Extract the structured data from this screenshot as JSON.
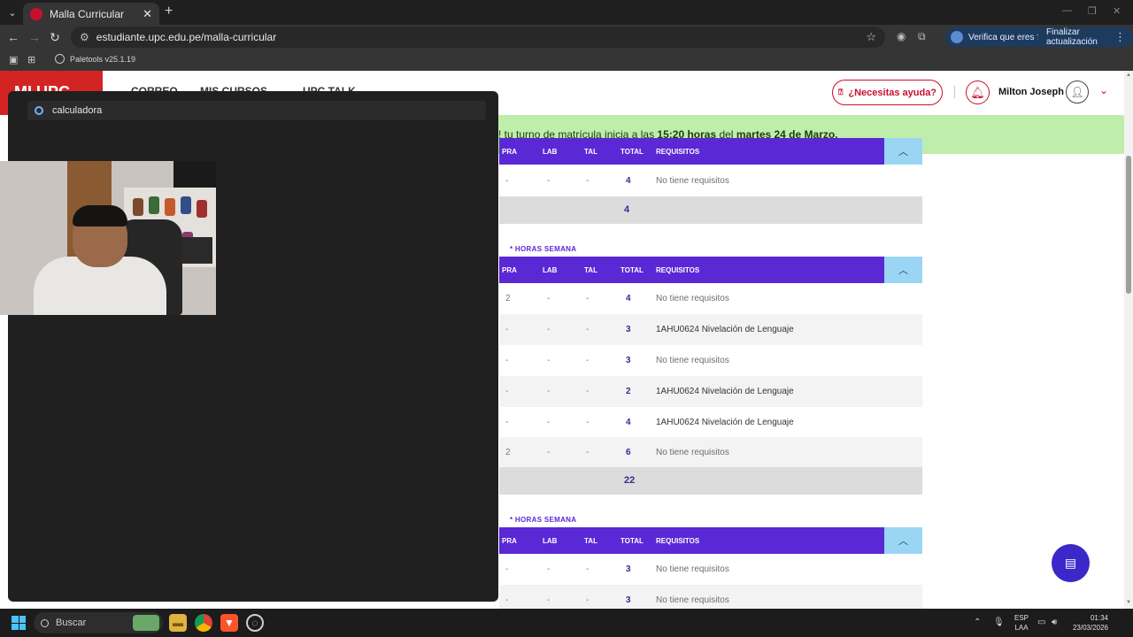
{
  "browser": {
    "tab_title": "Malla Curricular",
    "new_tab_icon": "+",
    "url": "estudiante.upc.edu.pe/malla-curricular",
    "verify_label": "Verifica que eres tú",
    "update_label": "Finalizar actualización",
    "bookmark": "Paletools v25.1.19"
  },
  "site": {
    "brand": "MI UPC",
    "nav": [
      "CORREO",
      "MIS CURSOS",
      "UPC TALK"
    ],
    "help_label": "¿Necesitas ayuda?",
    "user_name": "Milton Joseph",
    "accent": "#c8102e"
  },
  "banner": {
    "prefix": "! tu turno de matrícula inicia a las ",
    "time": "15:20 horas",
    "mid": " del ",
    "date": "martes 24 de Marzo.",
    "bg": "#bfedab"
  },
  "table": {
    "headers": {
      "pra": "PRA",
      "lab": "LAB",
      "tal": "TAL",
      "total": "TOTAL",
      "req": "REQUISITOS"
    },
    "hours_label": "* HORAS SEMANA",
    "header_color": "#5b28d6",
    "block1": {
      "rows": [
        {
          "pra": "-",
          "lab": "-",
          "tal": "-",
          "total": "4",
          "req": "No tiene requisitos"
        }
      ],
      "total": "4"
    },
    "block2": {
      "rows": [
        {
          "pra": "2",
          "lab": "-",
          "tal": "-",
          "total": "4",
          "req": "No tiene requisitos"
        },
        {
          "pra": "-",
          "lab": "-",
          "tal": "-",
          "total": "3",
          "req": "1AHU0624 Nivelación de Lenguaje"
        },
        {
          "pra": "-",
          "lab": "-",
          "tal": "-",
          "total": "3",
          "req": "No tiene requisitos"
        },
        {
          "pra": "-",
          "lab": "-",
          "tal": "-",
          "total": "2",
          "req": "1AHU0624 Nivelación de Lenguaje"
        },
        {
          "pra": "-",
          "lab": "-",
          "tal": "-",
          "total": "4",
          "req": "1AHU0624 Nivelación de Lenguaje"
        },
        {
          "pra": "2",
          "lab": "-",
          "tal": "-",
          "total": "6",
          "req": "No tiene requisitos"
        }
      ],
      "total": "22"
    },
    "block3": {
      "rows": [
        {
          "pra": "-",
          "lab": "-",
          "tal": "-",
          "total": "3",
          "req": "No tiene requisitos"
        },
        {
          "pra": "-",
          "lab": "-",
          "tal": "-",
          "total": "3",
          "req": "No tiene requisitos"
        }
      ]
    }
  },
  "launcher": {
    "query": "calculadora"
  },
  "taskbar": {
    "search_label": "Buscar",
    "lang_line1": "ESP",
    "lang_line2": "LAA",
    "time": "01:34",
    "date": "23/03/2026"
  }
}
